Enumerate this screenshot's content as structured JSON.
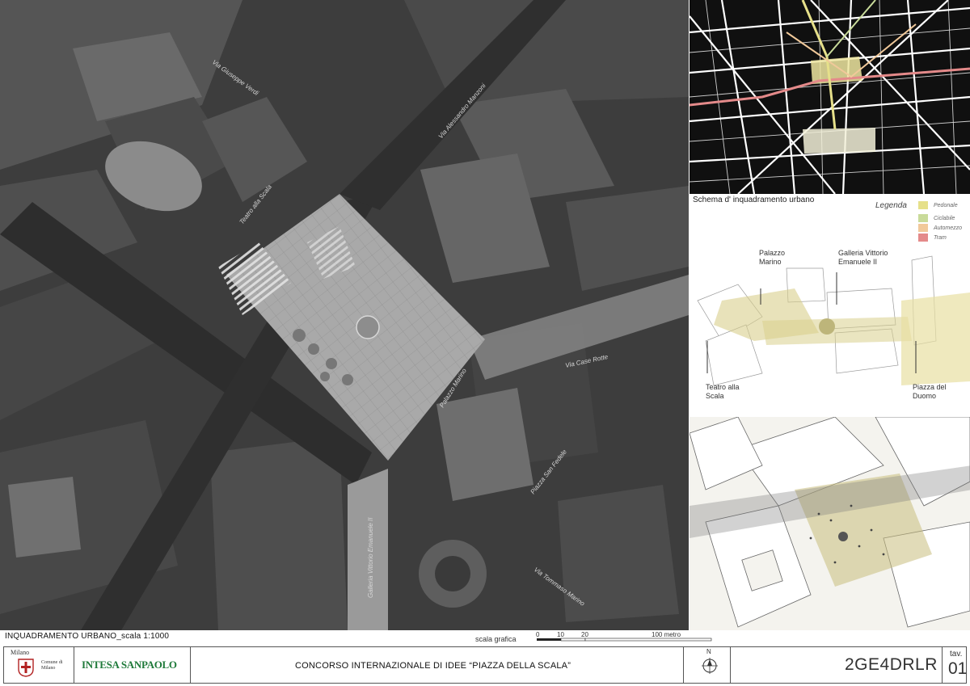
{
  "main_plan": {
    "street_labels": [
      "Via Giuseppe Verdi",
      "Via Alessandro Manzoni",
      "Teatro alla Scala",
      "Via Case Rotte",
      "Palazzo Marino",
      "Piazza San Fedele",
      "Galleria Vittorio Emanuele II",
      "Via Tommaso Marino"
    ]
  },
  "context_map": {
    "title": "Schema d' inquadramento urbano"
  },
  "legend": {
    "heading": "Legenda",
    "items": [
      {
        "label": "Pedonale",
        "color": "#e6e08a"
      },
      {
        "label": "Ciclabile",
        "color": "#c9db9a"
      },
      {
        "label": "Automezzo",
        "color": "#f1c99a"
      },
      {
        "label": "Tram",
        "color": "#e48a8a"
      }
    ]
  },
  "diagram": {
    "labels": {
      "palazzo_marino": "Palazzo Marino",
      "galleria": "Galleria Vittorio Emanuele II",
      "teatro": "Teatro alla Scala",
      "duomo": "Piazza del Duomo"
    },
    "highlight_color": "#d8cf8c"
  },
  "footer": {
    "plan_caption": "INQUADRAMENTO URBANO_scala 1:1000",
    "scale": {
      "title": "scala grafica",
      "ticks": [
        "0",
        "10",
        "20"
      ],
      "unit": "100 metro"
    },
    "logos": {
      "milano_word": "Milano",
      "comune_word": "Comune di Milano",
      "bank_name": "INTESA SANPAOLO"
    },
    "competition_title": "CONCORSO INTERNAZIONALE DI IDEE “PIAZZA  DELLA SCALA”",
    "north_label": "N",
    "project_code": "2GE4DRLR",
    "tav_label": "tav.",
    "tav_number": "01"
  }
}
